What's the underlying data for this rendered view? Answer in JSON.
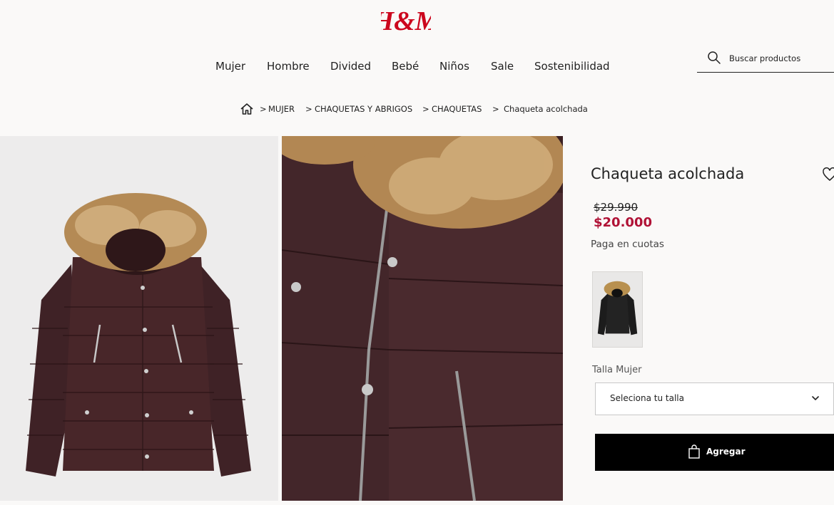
{
  "brand": {
    "logo_text": "H&M",
    "color": "#cc071e"
  },
  "nav": {
    "items": [
      {
        "label": "Mujer"
      },
      {
        "label": "Hombre"
      },
      {
        "label": "Divided"
      },
      {
        "label": "Bebé"
      },
      {
        "label": "Niños"
      },
      {
        "label": "Sale"
      },
      {
        "label": "Sostenibilidad"
      }
    ]
  },
  "search": {
    "placeholder": "Buscar productos",
    "icon": "search-icon"
  },
  "breadcrumb": {
    "home_icon": "home-icon",
    "items": [
      {
        "label": "MUJER"
      },
      {
        "label": "CHAQUETAS Y ABRIGOS"
      },
      {
        "label": "CHAQUETAS"
      },
      {
        "label": "Chaqueta acolchada"
      }
    ],
    "separator": ">"
  },
  "product": {
    "title": "Chaqueta acolchada",
    "price_old": "$29.990",
    "price_new": "$20.000",
    "installments": "Paga en cuotas",
    "price_color": "#b01236"
  },
  "size": {
    "label": "Talla Mujer",
    "select_text": "Seleciona tu talla"
  },
  "cart": {
    "add_label": "Agregar"
  }
}
